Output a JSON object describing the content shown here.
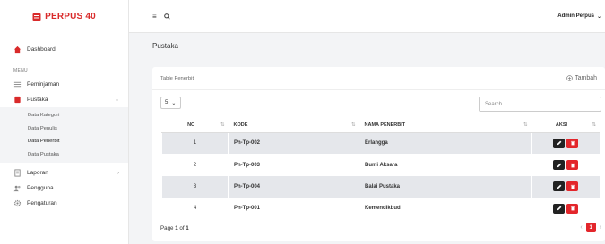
{
  "brand": {
    "name": "PERPUS 40",
    "color": "#d92a2a"
  },
  "sidebar": {
    "dashboard": "Dashboard",
    "section_label": "MENU",
    "items": [
      {
        "label": "Peminjaman",
        "icon": "list-icon"
      },
      {
        "label": "Pustaka",
        "icon": "book-icon"
      }
    ],
    "submenu": [
      {
        "label": "Data Kategori"
      },
      {
        "label": "Data Penulis"
      },
      {
        "label": "Data Penerbit",
        "active": true
      },
      {
        "label": "Data Pustaka"
      }
    ],
    "more": [
      {
        "label": "Laporan",
        "icon": "report-icon"
      },
      {
        "label": "Pengguna",
        "icon": "users-icon"
      },
      {
        "label": "Pengaturan",
        "icon": "gear-icon"
      }
    ]
  },
  "topbar": {
    "user": "Admin Perpus"
  },
  "page": {
    "title": "Pustaka"
  },
  "card": {
    "title": "Table Penerbit",
    "add_label": "Tambah",
    "page_size": "5",
    "search_placeholder": "Search..."
  },
  "table": {
    "headers": {
      "no": "NO",
      "kode": "KODE",
      "nama": "NAMA PENERBIT",
      "aksi": "AKSI"
    },
    "rows": [
      {
        "no": "1",
        "kode": "Pn-Tp-002",
        "nama": "Erlangga"
      },
      {
        "no": "2",
        "kode": "Pn-Tp-003",
        "nama": "Bumi Aksara"
      },
      {
        "no": "3",
        "kode": "Pn-Tp-004",
        "nama": "Balai Pustaka"
      },
      {
        "no": "4",
        "kode": "Pn-Tp-001",
        "nama": "Kemendikbud"
      }
    ]
  },
  "pagination": {
    "page_word": "Page",
    "current": "1",
    "of_word": "of",
    "total": "1"
  },
  "colors": {
    "accent": "#e3262b",
    "edit": "#222222"
  }
}
